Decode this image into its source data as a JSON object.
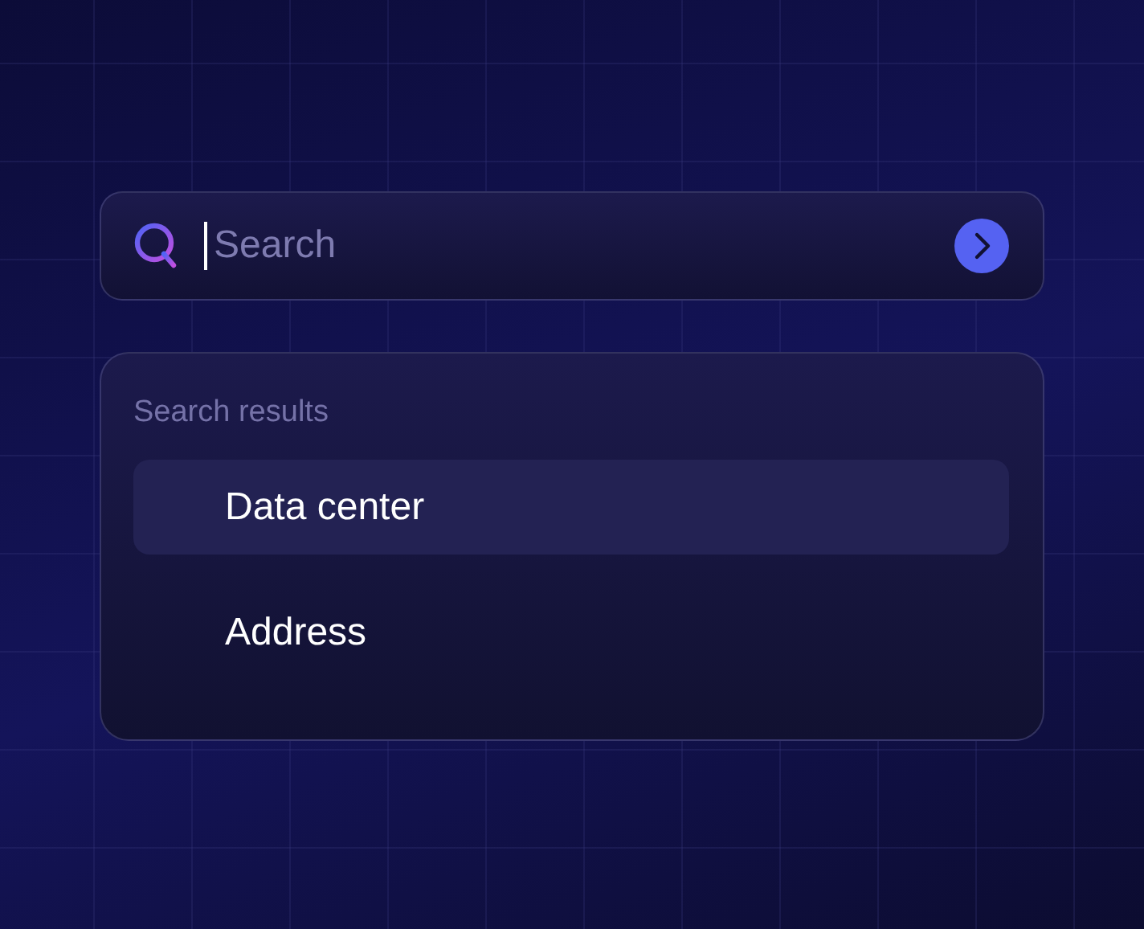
{
  "search": {
    "placeholder": "Search"
  },
  "results": {
    "heading": "Search results",
    "items": [
      {
        "label": "Data center",
        "selected": true
      },
      {
        "label": "Address",
        "selected": false
      }
    ]
  }
}
